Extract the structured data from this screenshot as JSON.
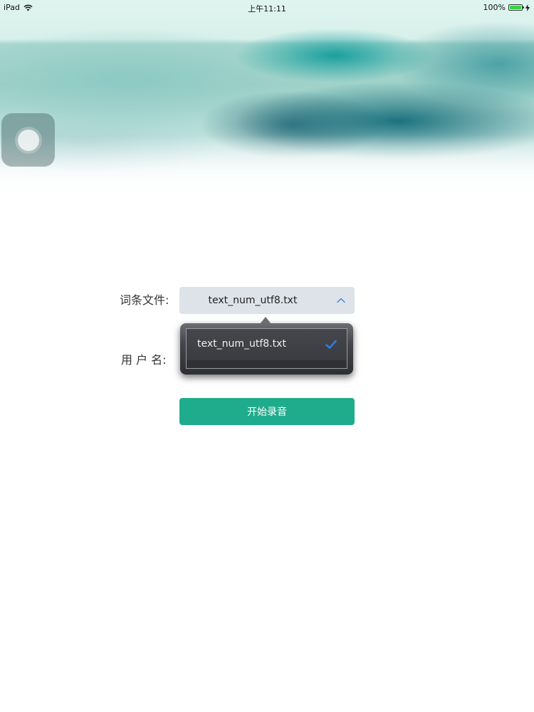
{
  "status_bar": {
    "device": "iPad",
    "time": "上午11:11",
    "battery": "100%"
  },
  "form": {
    "file_label": "词条文件:",
    "file_value": "text_num_utf8.txt",
    "user_label": "用 户 名:",
    "start_button": "开始录音"
  },
  "popover": {
    "options": [
      {
        "label": "text_num_utf8.txt",
        "selected": true
      }
    ]
  },
  "colors": {
    "accent": "#1fac8c",
    "select_bg": "#dde3e8",
    "checkmark": "#2f7de0"
  },
  "icons": {
    "wifi": "wifi-icon",
    "battery": "battery-icon",
    "chevron": "chevron-up-icon",
    "check": "checkmark-icon",
    "assistive": "assistive-touch-icon"
  }
}
